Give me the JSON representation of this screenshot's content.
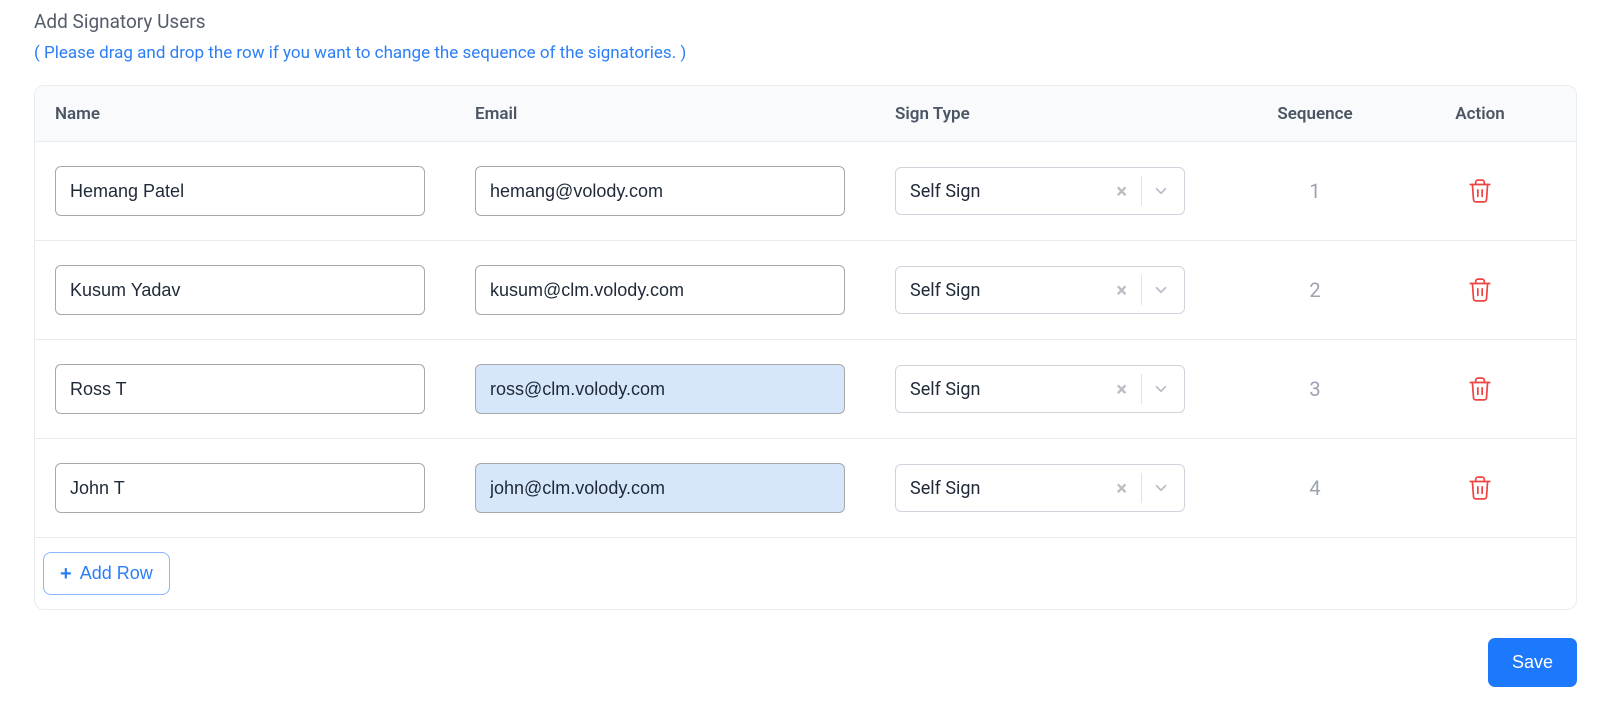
{
  "title": "Add Signatory Users",
  "hint": "( Please drag and drop the row if you want to change the sequence of the signatories. )",
  "columns": {
    "name": "Name",
    "email": "Email",
    "signType": "Sign Type",
    "sequence": "Sequence",
    "action": "Action"
  },
  "rows": [
    {
      "name": "Hemang Patel",
      "email": "hemang@volody.com",
      "signType": "Self Sign",
      "sequence": "1",
      "autofill": false
    },
    {
      "name": "Kusum Yadav",
      "email": "kusum@clm.volody.com",
      "signType": "Self Sign",
      "sequence": "2",
      "autofill": false
    },
    {
      "name": "Ross T",
      "email": "ross@clm.volody.com",
      "signType": "Self Sign",
      "sequence": "3",
      "autofill": true
    },
    {
      "name": "John T",
      "email": "john@clm.volody.com",
      "signType": "Self Sign",
      "sequence": "4",
      "autofill": true
    }
  ],
  "buttons": {
    "addRow": "Add Row",
    "save": "Save"
  }
}
